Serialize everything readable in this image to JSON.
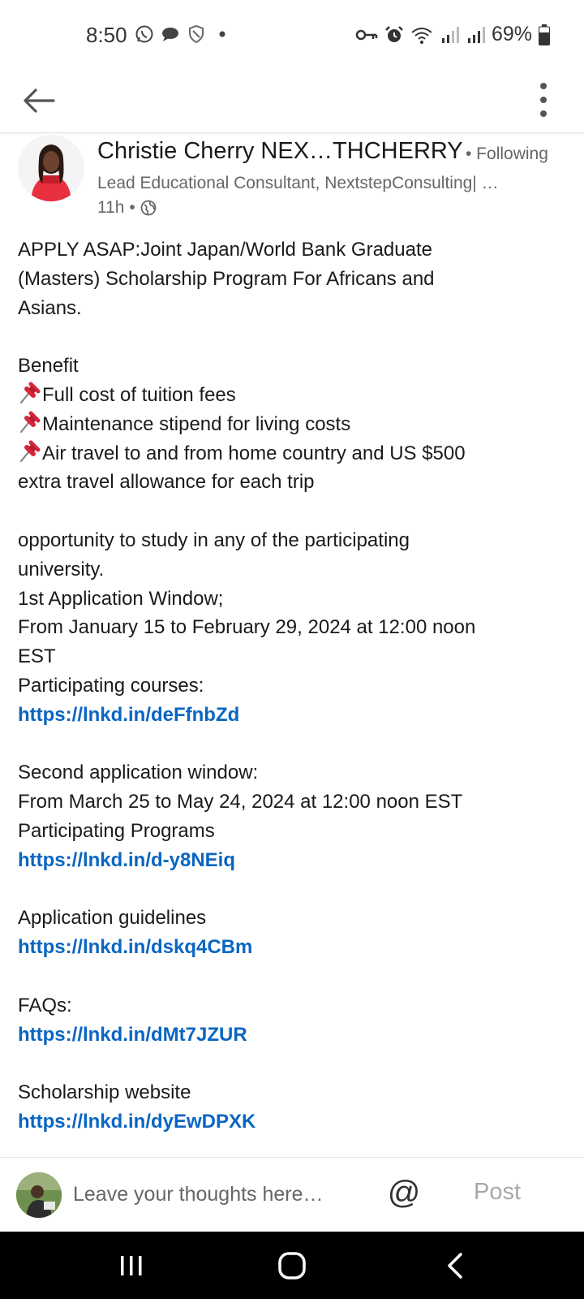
{
  "status_bar": {
    "time": "8:50",
    "battery_pct": "69%",
    "left_icons": [
      "whatsapp-icon",
      "chat-bubble-icon",
      "shield-icon",
      "dot-icon"
    ],
    "right_icons": [
      "vpn-key-icon",
      "alarm-icon",
      "wifi-icon",
      "signal-icon",
      "signal-icon",
      "battery-icon"
    ]
  },
  "app_bar": {
    "back_icon": "arrow-left-icon",
    "more_icon": "more-vertical-icon"
  },
  "post": {
    "author_name": "Christie Cherry NEX…THCHERRY",
    "follow_status": "• Following",
    "headline": "Lead Educational Consultant, NextstepConsulting| …",
    "time_ago": "11h •",
    "visibility_icon": "globe-icon",
    "lines": [
      {
        "text": "APPLY ASAP:Joint Japan/World Bank Graduate"
      },
      {
        "text": "(Masters) Scholarship Program For Africans and"
      },
      {
        "text": "Asians."
      },
      {
        "text": ""
      },
      {
        "text": "Benefit"
      },
      {
        "text": "Full cost of tuition fees",
        "pin": true
      },
      {
        "text": "Maintenance stipend for living costs",
        "pin": true
      },
      {
        "text": "Air travel to and from home country and US $500",
        "pin": true
      },
      {
        "text": "extra travel allowance for each trip"
      },
      {
        "text": ""
      },
      {
        "text": "opportunity to study in any of the participating"
      },
      {
        "text": "university."
      },
      {
        "text": "1st Application Window;"
      },
      {
        "text": "From January 15 to February 29, 2024 at 12:00 noon"
      },
      {
        "text": "EST"
      },
      {
        "text": "Participating courses:"
      },
      {
        "text": "https://lnkd.in/deFfnbZd",
        "link": true
      },
      {
        "text": ""
      },
      {
        "text": "Second application window:"
      },
      {
        "text": "From March 25 to May 24, 2024 at 12:00 noon EST"
      },
      {
        "text": "Participating Programs"
      },
      {
        "text": "https://lnkd.in/d-y8NEiq",
        "link": true
      },
      {
        "text": ""
      },
      {
        "text": "Application guidelines"
      },
      {
        "text": "https://lnkd.in/dskq4CBm",
        "link": true
      },
      {
        "text": ""
      },
      {
        "text": "FAQs:"
      },
      {
        "text": "https://lnkd.in/dMt7JZUR",
        "link": true
      },
      {
        "text": ""
      },
      {
        "text": "Scholarship website"
      },
      {
        "text": "https://lnkd.in/dyEwDPXK",
        "link": true
      }
    ]
  },
  "comment_bar": {
    "placeholder": "Leave your thoughts here…",
    "mention_symbol": "@",
    "post_label": "Post"
  },
  "nav_bar": {
    "buttons": [
      "recent-apps-icon",
      "home-icon",
      "back-icon"
    ]
  },
  "colors": {
    "link": "#0a66c2",
    "text": "#1a1a1a",
    "secondary": "#666666",
    "post_disabled": "#a8a8a8",
    "avatar_accent": "#e8303f"
  }
}
